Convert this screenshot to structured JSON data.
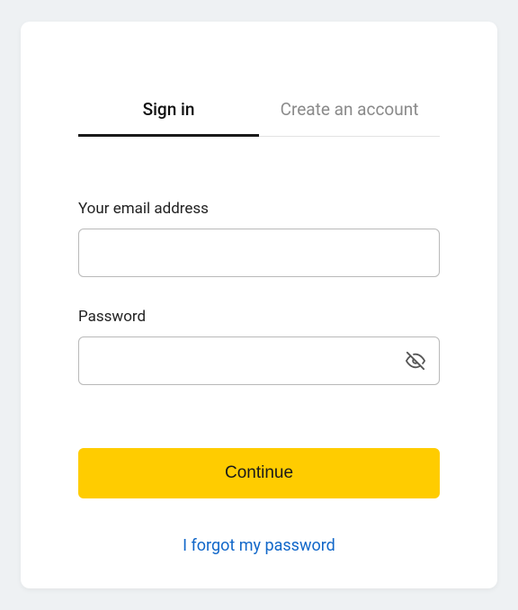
{
  "tabs": {
    "signin": "Sign in",
    "create": "Create an account"
  },
  "form": {
    "email_label": "Your email address",
    "email_value": "",
    "password_label": "Password",
    "password_value": ""
  },
  "actions": {
    "continue": "Continue",
    "forgot": "I forgot my password"
  }
}
